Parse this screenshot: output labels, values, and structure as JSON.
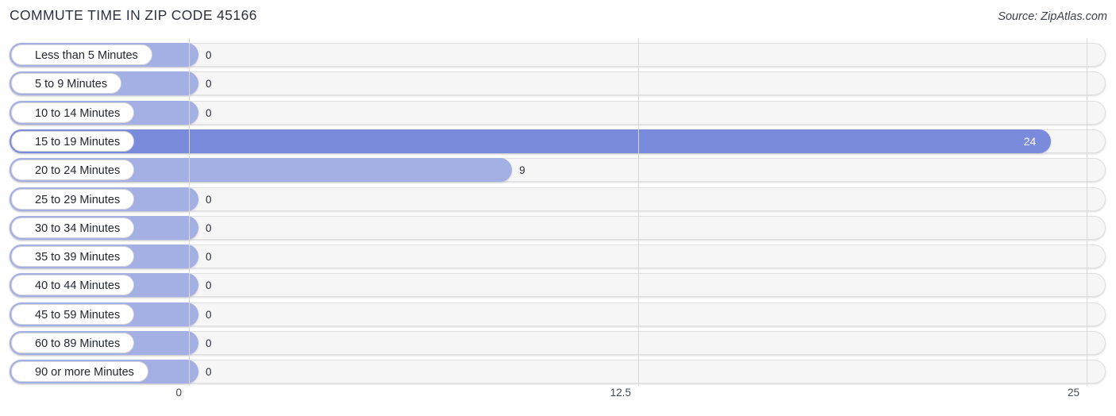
{
  "header": {
    "title": "COMMUTE TIME IN ZIP CODE 45166",
    "source": "Source: ZipAtlas.com"
  },
  "colors": {
    "bar_default": "#a4afe4",
    "bar_highlight": "#7b8bdc",
    "track": "#f6f6f7",
    "gridline": "#d8d8d8",
    "title_text": "#2c3040",
    "value_text": "#2a2d38",
    "value_text_inside": "#ffffff"
  },
  "chart_data": {
    "type": "bar",
    "orientation": "horizontal",
    "title": "COMMUTE TIME IN ZIP CODE 45166",
    "xlabel": "",
    "ylabel": "",
    "xlim": [
      0,
      25
    ],
    "grid": true,
    "legend": false,
    "source": "Source: ZipAtlas.com",
    "xticks": [
      "0",
      "12.5",
      "25"
    ],
    "xtick_values": [
      0,
      12.5,
      25
    ],
    "categories": [
      "Less than 5 Minutes",
      "5 to 9 Minutes",
      "10 to 14 Minutes",
      "15 to 19 Minutes",
      "20 to 24 Minutes",
      "25 to 29 Minutes",
      "30 to 34 Minutes",
      "35 to 39 Minutes",
      "40 to 44 Minutes",
      "45 to 59 Minutes",
      "60 to 89 Minutes",
      "90 or more Minutes"
    ],
    "values": [
      0,
      0,
      0,
      24,
      9,
      0,
      0,
      0,
      0,
      0,
      0,
      0
    ],
    "value_labels": [
      "0",
      "0",
      "0",
      "24",
      "9",
      "0",
      "0",
      "0",
      "0",
      "0",
      "0",
      "0"
    ],
    "max_value_index": 3
  }
}
